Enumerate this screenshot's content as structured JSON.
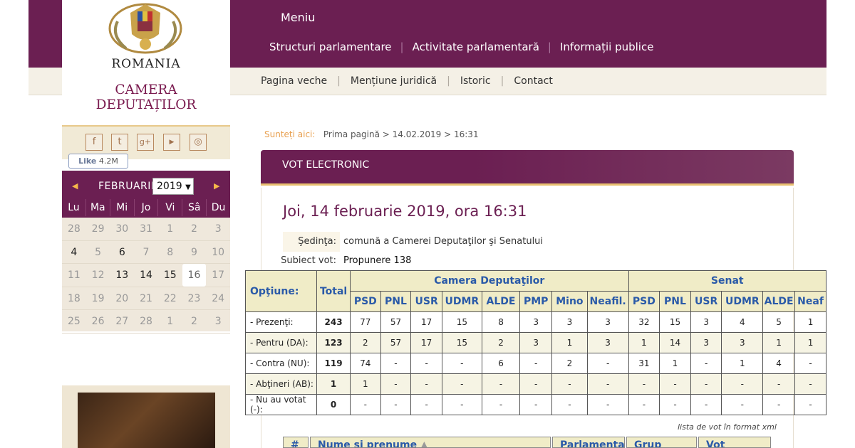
{
  "logo": {
    "country": "ROMANIA",
    "institution_line1": "CAMERA",
    "institution_line2": "DEPUTAȚILOR"
  },
  "social": {
    "icons": [
      "facebook-icon",
      "twitter-icon",
      "google-plus-icon",
      "youtube-icon",
      "instagram-icon"
    ],
    "like_label": "Like",
    "like_count": "4.2M"
  },
  "header": {
    "menu_title": "Meniu",
    "main_nav": [
      "Structuri parlamentare",
      "Activitate parlamentară",
      "Informații publice"
    ],
    "sub_nav": [
      "Pagina veche",
      "Mențiune juridică",
      "Istoric",
      "Contact"
    ]
  },
  "calendar": {
    "month": "FEBRUARIE",
    "year": "2019",
    "weekdays": [
      "Lu",
      "Ma",
      "Mi",
      "Jo",
      "Vi",
      "Sâ",
      "Du"
    ],
    "weeks": [
      [
        "28",
        "29",
        "30",
        "31",
        "1",
        "2",
        "3"
      ],
      [
        "4",
        "5",
        "6",
        "7",
        "8",
        "9",
        "10"
      ],
      [
        "11",
        "12",
        "13",
        "14",
        "15",
        "16",
        "17"
      ],
      [
        "18",
        "19",
        "20",
        "21",
        "22",
        "23",
        "24"
      ],
      [
        "25",
        "26",
        "27",
        "28",
        "1",
        "2",
        "3"
      ]
    ],
    "active_days": [
      "4",
      "6",
      "13",
      "14",
      "15"
    ],
    "today": "16"
  },
  "breadcrumb": {
    "label": "Sunteți aici:",
    "path": "Prima pagină > 14.02.2019 > 16:31"
  },
  "panel": {
    "title": "VOT ELECTRONIC"
  },
  "vote": {
    "date_title": "Joi, 14 februarie 2019, ora 16:31",
    "session_label": "Şedinţa:",
    "session_value": "comună a Camerei Deputaţilor şi Senatului",
    "subject_label": "Subiect vot:",
    "subject_value": "Propunere 138"
  },
  "results": {
    "option_header": "Opţiune:",
    "total_header": "Total",
    "chamber1": "Camera Deputaţilor",
    "chamber2": "Senat",
    "cd_parties": [
      "PSD",
      "PNL",
      "USR",
      "UDMR",
      "ALDE",
      "PMP",
      "Mino",
      "Neafil."
    ],
    "senat_parties": [
      "PSD",
      "PNL",
      "USR",
      "UDMR",
      "ALDE",
      "Neaf"
    ],
    "rows": [
      {
        "label": "- Prezenţi:",
        "total": "243",
        "cd": [
          "77",
          "57",
          "17",
          "15",
          "8",
          "3",
          "3",
          "3"
        ],
        "senat": [
          "32",
          "15",
          "3",
          "4",
          "5",
          "1"
        ]
      },
      {
        "label": "- Pentru (DA):",
        "total": "123",
        "cd": [
          "2",
          "57",
          "17",
          "15",
          "2",
          "3",
          "1",
          "3"
        ],
        "senat": [
          "1",
          "14",
          "3",
          "3",
          "1",
          "1"
        ]
      },
      {
        "label": "- Contra (NU):",
        "total": "119",
        "cd": [
          "74",
          "-",
          "-",
          "-",
          "6",
          "-",
          "2",
          "-"
        ],
        "senat": [
          "31",
          "1",
          "-",
          "1",
          "4",
          "-"
        ]
      },
      {
        "label": "- Abţineri (AB):",
        "total": "1",
        "cd": [
          "1",
          "-",
          "-",
          "-",
          "-",
          "-",
          "-",
          "-"
        ],
        "senat": [
          "-",
          "-",
          "-",
          "-",
          "-",
          "-"
        ]
      },
      {
        "label": "- Nu au votat (-):",
        "total": "0",
        "cd": [
          "-",
          "-",
          "-",
          "-",
          "-",
          "-",
          "-",
          "-"
        ],
        "senat": [
          "-",
          "-",
          "-",
          "-",
          "-",
          "-"
        ]
      }
    ]
  },
  "xml_link": "lista de vot în format xml",
  "list_headers": [
    "#",
    "Nume şi prenume",
    "Parlamentar",
    "Grup",
    "Vot"
  ]
}
